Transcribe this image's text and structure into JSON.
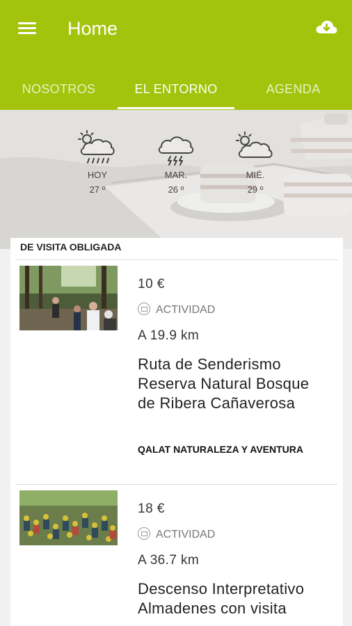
{
  "appbar": {
    "title": "Home",
    "menu_icon": "menu-icon",
    "action_icon": "cloud-download-icon"
  },
  "tabs": [
    {
      "label": "NOSOTROS"
    },
    {
      "label": "EL ENTORNO"
    },
    {
      "label": "AGENDA"
    }
  ],
  "weather": [
    {
      "day": "HOY",
      "temp": "27 º",
      "icon": "sun-cloud-rain-icon"
    },
    {
      "day": "MAR.",
      "temp": "26 º",
      "icon": "cloud-storm-icon"
    },
    {
      "day": "MIÉ.",
      "temp": "29 º",
      "icon": "sun-cloud-icon"
    }
  ],
  "section": {
    "title": "DE VISITA OBLIGADA"
  },
  "items": [
    {
      "price": "10 €",
      "kind": "ACTIVIDAD",
      "distance": "A 19.9 km",
      "name": "Ruta de Senderismo Reserva Natural Bosque de Ribera Cañaverosa",
      "organizer": "QALAT NATURALEZA Y AVENTURA"
    },
    {
      "price": "18 €",
      "kind": "ACTIVIDAD",
      "distance": "A 36.7 km",
      "name": "Descenso Interpretativo Almadenes con visita",
      "organizer": ""
    }
  ],
  "colors": {
    "appbar": "#a3c30d",
    "text": "#222222"
  }
}
